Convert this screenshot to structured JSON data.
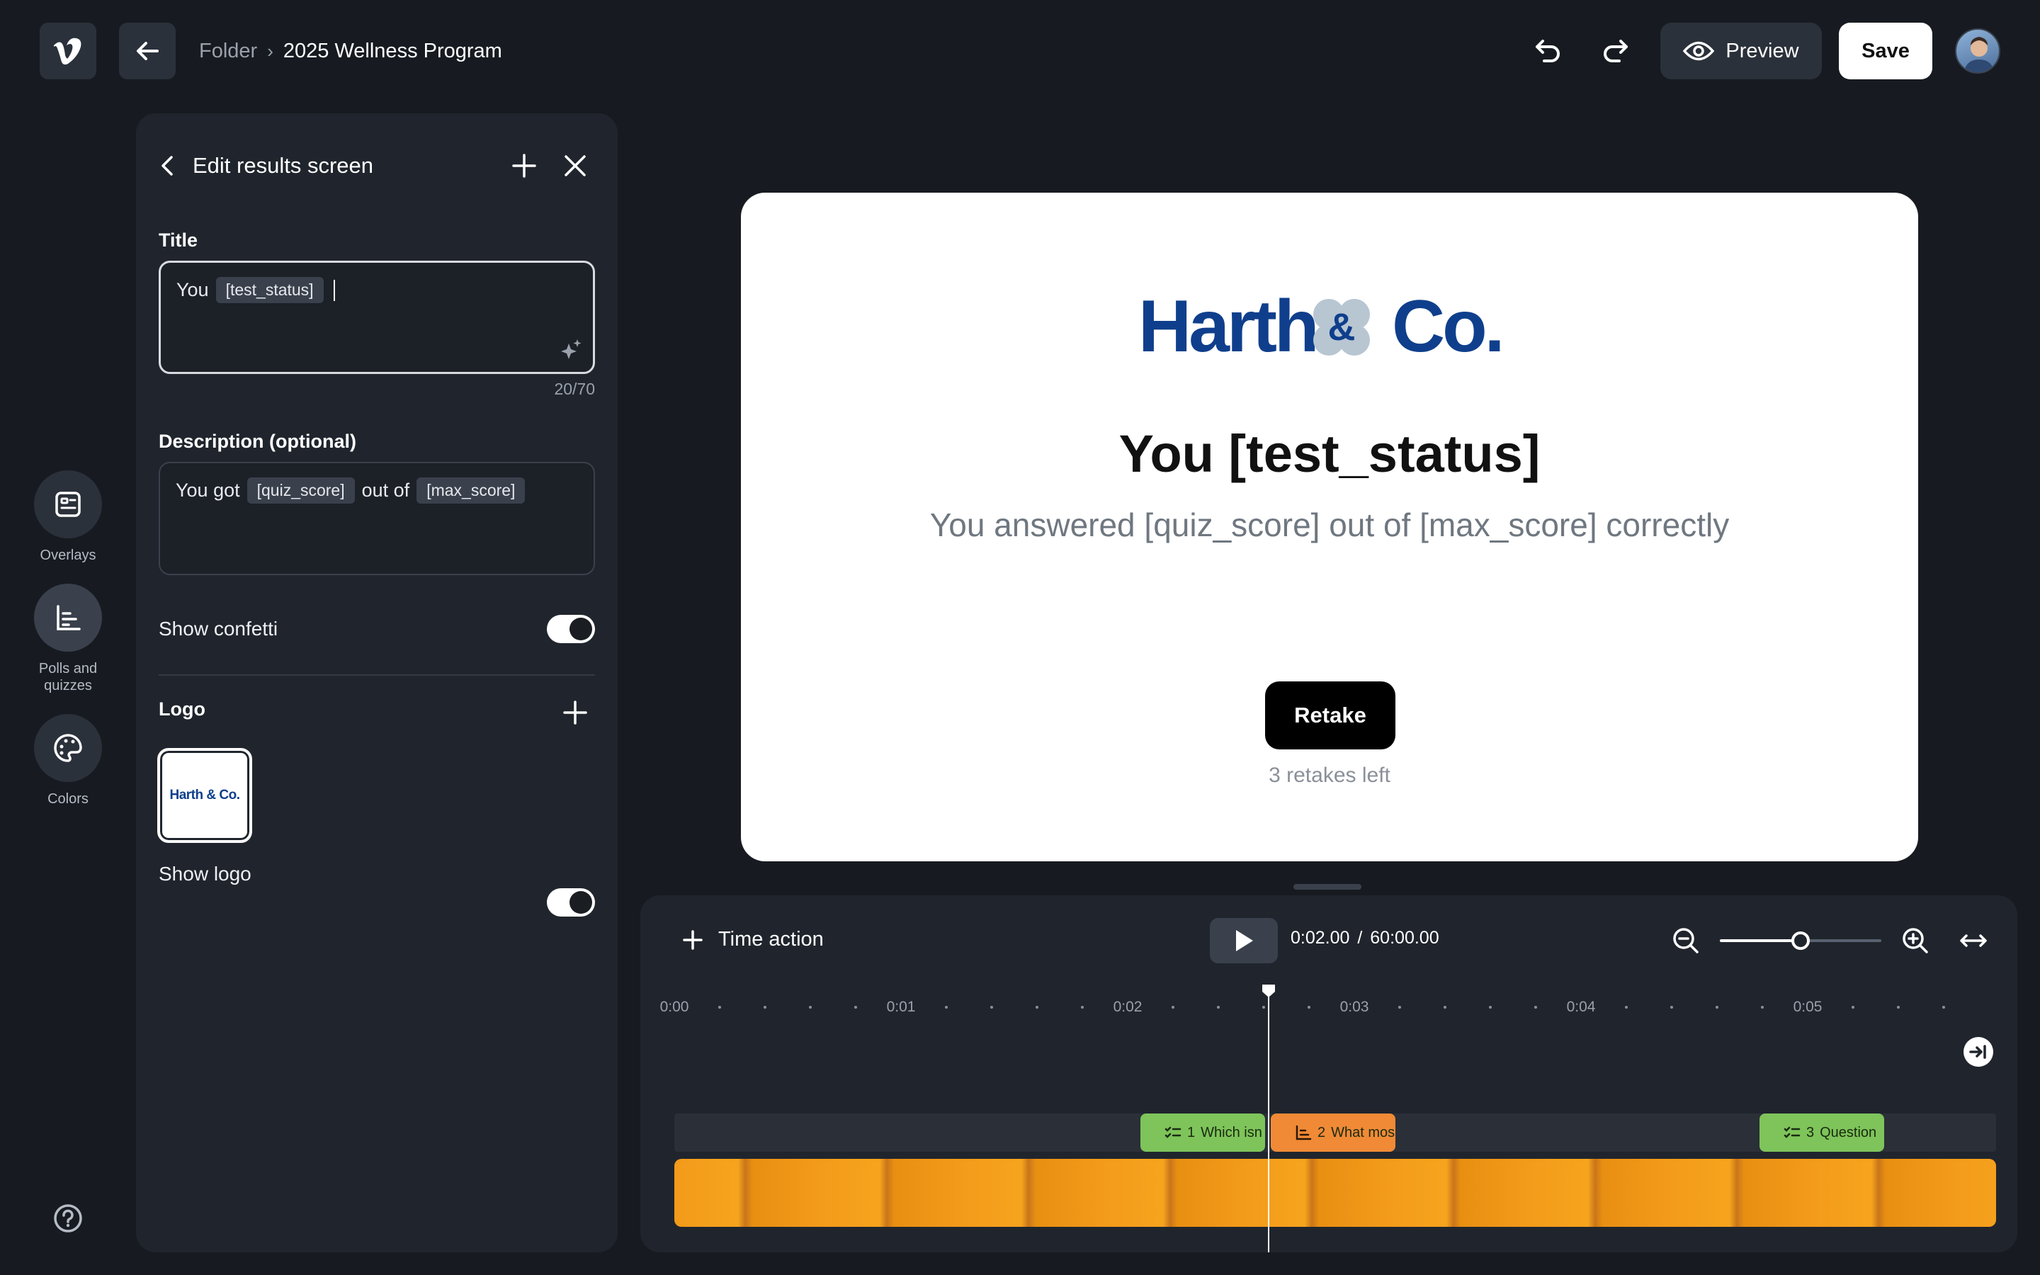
{
  "app": {
    "logo": "vimeo-logo"
  },
  "breadcrumb": {
    "folder": "Folder",
    "current": "2025 Wellness Program"
  },
  "toolbar": {
    "preview_label": "Preview",
    "save_label": "Save"
  },
  "rail": {
    "overlays": "Overlays",
    "polls": "Polls and quizzes",
    "colors": "Colors"
  },
  "panel": {
    "title": "Edit results screen",
    "title_label": "Title",
    "title_text": "You",
    "title_chip": "[test_status]",
    "title_count": "20/70",
    "desc_label": "Description (optional)",
    "desc_text_1": "You got",
    "desc_chip_1": "[quiz_score]",
    "desc_text_2": "out of",
    "desc_chip_2": "[max_score]",
    "confetti_label": "Show confetti",
    "confetti_on": true,
    "logo_label": "Logo",
    "logo_thumb_text": "Harth & Co.",
    "show_logo_label": "Show logo",
    "show_logo_on": true
  },
  "card": {
    "brand": "Harth & Co.",
    "title": "You [test_status]",
    "description": "You answered [quiz_score] out of [max_score] correctly",
    "retake_label": "Retake",
    "retakes_left": "3 retakes left"
  },
  "timeline": {
    "time_action_label": "Time action",
    "current_time": "0:02.00",
    "separator": "/",
    "total_time": "60:00.00",
    "zoom_level": 0.5,
    "ticks": [
      "0:00",
      "0:01",
      "0:02",
      "0:03",
      "0:04",
      "0:05"
    ],
    "markers": [
      {
        "index": "1",
        "label": "Which isn",
        "color": "#7ec45a"
      },
      {
        "index": "2",
        "label": "What mos",
        "color": "#f08a36"
      },
      {
        "index": "3",
        "label": "Question",
        "color": "#7ec45a"
      }
    ]
  },
  "colors": {
    "brand_blue": "#0f3f8c",
    "bg": "#171b21",
    "panel": "#20252d"
  }
}
